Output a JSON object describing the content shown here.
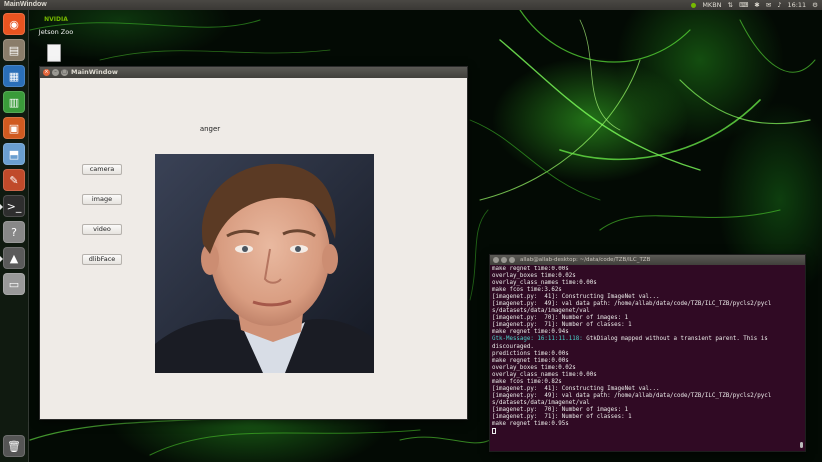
{
  "top_panel": {
    "window_title": "MainWindow",
    "input_method": "MKBN",
    "clock": "16:11"
  },
  "desktop": {
    "nvidia_logo": "NVIDIA",
    "icons": [
      {
        "label": "Jetson Zoo",
        "icon": "nvidia-app-icon"
      },
      {
        "label": "",
        "icon": "document-file-icon"
      }
    ]
  },
  "launcher": {
    "items": [
      {
        "name": "ubuntu-dash-icon",
        "color": "#e95420"
      },
      {
        "name": "files-icon",
        "color": "#8a7d6a"
      },
      {
        "name": "writer-icon",
        "color": "#2a6fb8"
      },
      {
        "name": "calc-icon",
        "color": "#3a9b3a"
      },
      {
        "name": "impress-icon",
        "color": "#d05a20"
      },
      {
        "name": "software-center-icon",
        "color": "#6a9fd0"
      },
      {
        "name": "system-settings-icon",
        "color": "#c04a2a"
      },
      {
        "name": "terminal-icon",
        "color": "#3a3a3a"
      },
      {
        "name": "help-icon",
        "color": "#888888"
      },
      {
        "name": "synaptic-icon",
        "color": "#5a5a5a"
      },
      {
        "name": "drive-icon",
        "color": "#999999"
      }
    ],
    "trash_icon": "trash-icon"
  },
  "main_window": {
    "title": "MainWindow",
    "emotion_label": "anger",
    "buttons": {
      "camera": "camera",
      "image": "image",
      "video": "video",
      "dlibface": "dlibFace"
    },
    "photo_description": "face-photo"
  },
  "terminal": {
    "title": "allab@allab-desktop: ~/data/code/TZB/ILC_TZB",
    "lines": [
      "make regnet time:0.00s",
      "overlay_boxes time:0.02s",
      "overlay_class_names time:0.00s",
      "make fcos time:3.62s",
      "[imagenet.py:  41]: Constructing ImageNet val...",
      "[imagenet.py:  49]: val data path: /home/allab/data/code/TZB/ILC_TZB/pycls2/pycl",
      "s/datasets/data/imagenet/val",
      "[imagenet.py:  70]: Number of images: 1",
      "[imagenet.py:  71]: Number of classes: 1",
      "make regnet time:0.94s"
    ],
    "gtk_prefix": "Gtk-Message:",
    "gtk_time": "16:11:11.118:",
    "gtk_message": " GtkDialog mapped without a transient parent. This is",
    "lines2": [
      "discouraged.",
      "predictions time:0.00s",
      "make regnet time:0.00s",
      "overlay_boxes time:0.02s",
      "overlay_class_names time:0.00s",
      "make fcos time:0.82s",
      "[imagenet.py:  41]: Constructing ImageNet val...",
      "[imagenet.py:  49]: val data path: /home/allab/data/code/TZB/ILC_TZB/pycls2/pycl",
      "s/datasets/data/imagenet/val",
      "[imagenet.py:  70]: Number of images: 1",
      "[imagenet.py:  71]: Number of classes: 1",
      "make regnet time:0.95s"
    ]
  }
}
